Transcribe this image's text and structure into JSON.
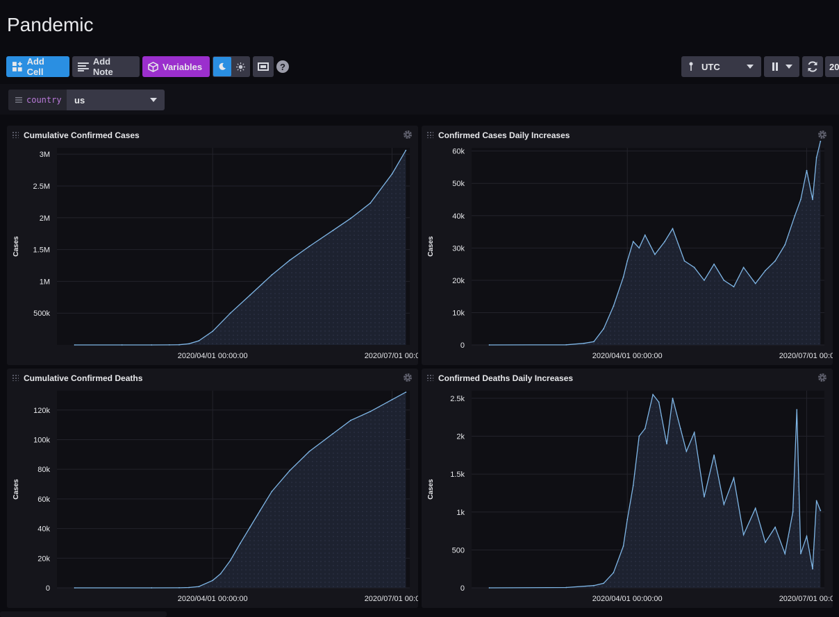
{
  "page": {
    "title": "Pandemic"
  },
  "toolbar": {
    "add_cell": "Add Cell",
    "add_note": "Add Note",
    "variables": "Variables",
    "help": "?",
    "timezone": "UTC",
    "time_range_partial": "20"
  },
  "variables": {
    "key": "country",
    "value": "us"
  },
  "colors": {
    "accent_blue": "#2a8fe2",
    "variables_purple": "#9b2fcd",
    "line": "#7fb6e6"
  },
  "cells": [
    {
      "title": "Cumulative Confirmed Cases"
    },
    {
      "title": "Confirmed Cases Daily Increases"
    },
    {
      "title": "Cumulative Confirmed Deaths"
    },
    {
      "title": "Confirmed Deaths Daily Increases"
    }
  ],
  "chart_data": [
    {
      "type": "area",
      "title": "Cumulative Confirmed Cases",
      "ylabel": "Cases",
      "yticks": [
        "3M",
        "2.5M",
        "2M",
        "1.5M",
        "1M",
        "500k"
      ],
      "ytick_values": [
        3000000,
        2500000,
        2000000,
        1500000,
        1000000,
        500000
      ],
      "xticks": [
        "2020/04/01 00:00:00",
        "2020/07/01 00:0"
      ],
      "ylim": [
        0,
        3100000
      ],
      "x": [
        "2020-01-22",
        "2020-02-15",
        "2020-03-01",
        "2020-03-10",
        "2020-03-15",
        "2020-03-20",
        "2020-03-25",
        "2020-04-01",
        "2020-04-10",
        "2020-04-20",
        "2020-05-01",
        "2020-05-10",
        "2020-05-20",
        "2020-06-01",
        "2020-06-10",
        "2020-06-20",
        "2020-07-01",
        "2020-07-08"
      ],
      "values": [
        1,
        15,
        75,
        1000,
        3500,
        19000,
        65000,
        215000,
        500000,
        785000,
        1100000,
        1330000,
        1550000,
        1800000,
        1990000,
        2230000,
        2690000,
        3060000
      ]
    },
    {
      "type": "line",
      "title": "Confirmed Cases Daily Increases",
      "ylabel": "Cases",
      "yticks": [
        "60k",
        "50k",
        "40k",
        "30k",
        "20k",
        "10k",
        "0"
      ],
      "ytick_values": [
        60000,
        50000,
        40000,
        30000,
        20000,
        10000,
        0
      ],
      "xticks": [
        "2020/04/01 00:00:00",
        "2020/07/01 00:0"
      ],
      "ylim": [
        0,
        61000
      ],
      "x": [
        "2020-01-22",
        "2020-03-01",
        "2020-03-10",
        "2020-03-15",
        "2020-03-20",
        "2020-03-25",
        "2020-03-30",
        "2020-04-01",
        "2020-04-04",
        "2020-04-07",
        "2020-04-10",
        "2020-04-15",
        "2020-04-20",
        "2020-04-24",
        "2020-04-30",
        "2020-05-05",
        "2020-05-10",
        "2020-05-15",
        "2020-05-20",
        "2020-05-25",
        "2020-05-30",
        "2020-06-05",
        "2020-06-10",
        "2020-06-15",
        "2020-06-20",
        "2020-06-25",
        "2020-06-28",
        "2020-07-01",
        "2020-07-04",
        "2020-07-06",
        "2020-07-08"
      ],
      "values": [
        0,
        50,
        500,
        1000,
        5000,
        12000,
        21000,
        26000,
        32000,
        30000,
        34000,
        28000,
        32000,
        36000,
        26000,
        24000,
        20000,
        25000,
        20000,
        18000,
        24000,
        19000,
        23000,
        26000,
        31000,
        40000,
        45000,
        54000,
        45000,
        58000,
        63000
      ]
    },
    {
      "type": "area",
      "title": "Cumulative Confirmed Deaths",
      "ylabel": "Cases",
      "yticks": [
        "120k",
        "100k",
        "80k",
        "60k",
        "40k",
        "20k",
        "0"
      ],
      "ytick_values": [
        120000,
        100000,
        80000,
        60000,
        40000,
        20000,
        0
      ],
      "xticks": [
        "2020/04/01 00:00:00",
        "2020/07/01 00:0"
      ],
      "ylim": [
        0,
        133000
      ],
      "x": [
        "2020-01-22",
        "2020-03-01",
        "2020-03-15",
        "2020-03-20",
        "2020-03-25",
        "2020-04-01",
        "2020-04-05",
        "2020-04-10",
        "2020-04-15",
        "2020-04-20",
        "2020-04-25",
        "2020-05-01",
        "2020-05-10",
        "2020-05-20",
        "2020-06-01",
        "2020-06-10",
        "2020-06-20",
        "2020-07-01",
        "2020-07-08"
      ],
      "values": [
        0,
        1,
        60,
        250,
        900,
        5000,
        9500,
        18500,
        30000,
        41000,
        52000,
        65000,
        79000,
        92000,
        104000,
        113000,
        119000,
        127000,
        132000
      ]
    },
    {
      "type": "line",
      "title": "Confirmed Deaths Daily Increases",
      "ylabel": "Cases",
      "yticks": [
        "2.5k",
        "2k",
        "1.5k",
        "1k",
        "500",
        "0"
      ],
      "ytick_values": [
        2500,
        2000,
        1500,
        1000,
        500,
        0
      ],
      "xticks": [
        "2020/04/01 00:00:00",
        "2020/07/01 00:0"
      ],
      "ylim": [
        0,
        2600
      ],
      "x": [
        "2020-01-22",
        "2020-03-01",
        "2020-03-15",
        "2020-03-20",
        "2020-03-25",
        "2020-03-30",
        "2020-04-01",
        "2020-04-04",
        "2020-04-07",
        "2020-04-10",
        "2020-04-14",
        "2020-04-17",
        "2020-04-21",
        "2020-04-24",
        "2020-04-28",
        "2020-05-01",
        "2020-05-05",
        "2020-05-10",
        "2020-05-15",
        "2020-05-20",
        "2020-05-25",
        "2020-05-30",
        "2020-06-05",
        "2020-06-10",
        "2020-06-15",
        "2020-06-20",
        "2020-06-24",
        "2020-06-26",
        "2020-06-28",
        "2020-07-01",
        "2020-07-04",
        "2020-07-06",
        "2020-07-08"
      ],
      "values": [
        0,
        5,
        30,
        60,
        200,
        550,
        900,
        1350,
        2000,
        2100,
        2550,
        2450,
        1900,
        2500,
        2100,
        1800,
        2050,
        1200,
        1750,
        1100,
        1450,
        700,
        1050,
        600,
        800,
        450,
        1000,
        2350,
        450,
        680,
        250,
        1150,
        1020
      ]
    }
  ]
}
